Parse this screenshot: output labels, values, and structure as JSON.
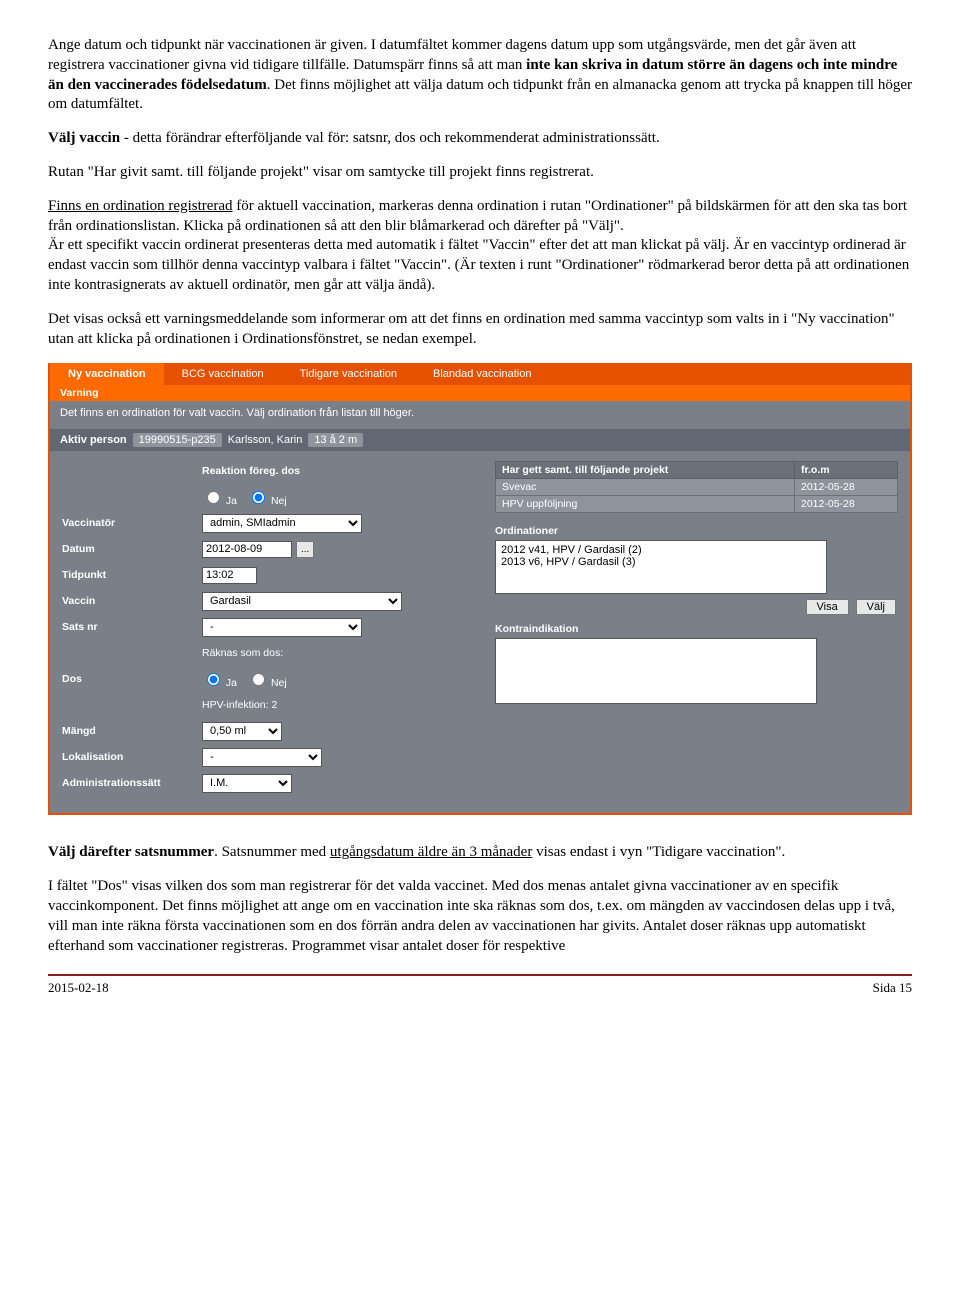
{
  "para1_a": "Ange datum och tidpunkt när vaccinationen är given. I datumfältet kommer dagens datum upp som utgångsvärde, men det går även att registrera vaccinationer givna vid tidigare tillfälle. Datumspärr finns så att man ",
  "para1_b": "inte kan skriva in datum större än dagens och inte mindre än den vaccinerades födelsedatum",
  "para1_c": ". Det finns möjlighet att välja datum och tidpunkt från en almanacka genom att trycka på knappen till höger om datumfältet.",
  "para2_a": "Välj vaccin",
  "para2_b": " - detta förändrar efterföljande val för: satsnr, dos och rekommenderat administrationssätt.",
  "para3": "Rutan \"Har givit samt. till följande projekt\" visar om samtycke till projekt finns registrerat.",
  "para4_a": "Finns en ordination registrerad",
  "para4_b": " för aktuell vaccination, markeras denna ordination i rutan \"Ordinationer\" på bildskärmen för att den ska tas bort från ordinationslistan. Klicka på ordinationen så att den blir blåmarkerad och därefter på \"Välj\".",
  "para4_c": "Är ett specifikt vaccin ordinerat presenteras detta med automatik i fältet \"Vaccin\" efter det att man klickat på välj. Är en vaccintyp ordinerad är endast vaccin som tillhör denna vaccintyp valbara i fältet \"Vaccin\". (Är texten i runt \"Ordinationer\" rödmarkerad beror detta på att ordinationen inte kontrasignerats av aktuell ordinatör, men går att välja ändå).",
  "para5": "Det visas också ett varningsmeddelande som informerar om att det finns en ordination med samma vaccintyp som valts in i \"Ny vaccination\" utan att klicka på ordinationen i Ordinationsfönstret, se nedan exempel.",
  "ui": {
    "tabs": [
      "Ny vaccination",
      "BCG vaccination",
      "Tidigare vaccination",
      "Blandad vaccination"
    ],
    "warn_title": "Varning",
    "warn_text": "Det finns en ordination för valt vaccin. Välj ordination från listan till höger.",
    "aktiv_label": "Aktiv person",
    "aktiv_pnr": "19990515-p235",
    "aktiv_name": "Karlsson, Karin",
    "aktiv_age": "13 å 2 m",
    "labels": {
      "reaktion": "Reaktion föreg. dos",
      "ja": "Ja",
      "nej": "Nej",
      "vaccinator": "Vaccinatör",
      "datum": "Datum",
      "tidpunkt": "Tidpunkt",
      "vaccin": "Vaccin",
      "satsnr": "Sats nr",
      "raknas": "Räknas som dos:",
      "hpvinf": "HPV-infektion: 2",
      "dos": "Dos",
      "mangd": "Mängd",
      "lokal": "Lokalisation",
      "admin": "Administrationssätt",
      "samtycke_h": "Har gett samt. till följande projekt",
      "from": "fr.o.m",
      "ord": "Ordinationer",
      "kontra": "Kontraindikation",
      "visa": "Visa",
      "valj": "Välj"
    },
    "values": {
      "vaccinator": "admin, SMIadmin",
      "datum": "2012-08-09",
      "tidpunkt": "13:02",
      "vaccin": "Gardasil",
      "satsnr": "-",
      "mangd": "0,50 ml",
      "lokal": "-",
      "admin": "I.M."
    },
    "samtycke": [
      {
        "proj": "Svevac",
        "from": "2012-05-28"
      },
      {
        "proj": "HPV uppföljning",
        "from": "2012-05-28"
      }
    ],
    "ordinationer": [
      "2012 v41, HPV / Gardasil (2)",
      "2013 v6, HPV / Gardasil (3)"
    ]
  },
  "para6_a": "Välj därefter satsnummer",
  "para6_b": ". Satsnummer med ",
  "para6_c": "utgångsdatum äldre än 3 månader",
  "para6_d": " visas endast i vyn \"Tidigare vaccination\".",
  "para7": "I fältet \"Dos\" visas vilken dos som man registrerar för det valda vaccinet. Med dos menas antalet givna vaccinationer av en specifik vaccinkomponent. Det finns möjlighet att ange om en vaccination inte ska räknas som dos, t.ex. om mängden av vaccindosen delas upp i två, vill man inte räkna första vaccinationen som en dos förrän andra delen av vaccinationen har givits. Antalet doser räknas upp automatiskt efterhand som vaccinationer registreras. Programmet visar antalet doser för respektive",
  "footer_date": "2015-02-18",
  "footer_page": "Sida 15"
}
